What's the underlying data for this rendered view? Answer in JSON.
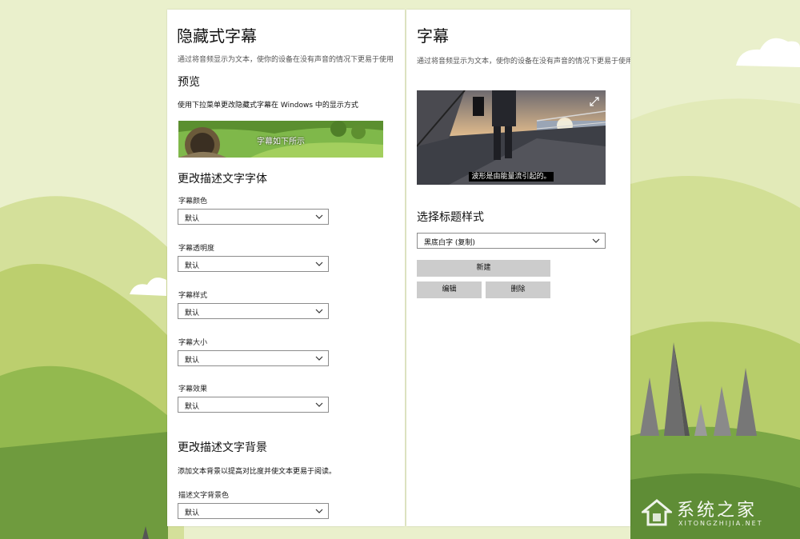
{
  "left": {
    "title": "隐藏式字幕",
    "description": "通过将音频显示为文本，使你的设备在没有声音的情况下更易于使用",
    "preview_heading": "预览",
    "preview_text": "使用下拉菜单更改隐藏式字幕在 Windows 中的显示方式",
    "preview_caption": "字幕如下所示",
    "font_heading": "更改描述文字字体",
    "font_settings": [
      {
        "label": "字幕颜色",
        "value": "默认"
      },
      {
        "label": "字幕透明度",
        "value": "默认"
      },
      {
        "label": "字幕样式",
        "value": "默认"
      },
      {
        "label": "字幕大小",
        "value": "默认"
      },
      {
        "label": "字幕效果",
        "value": "默认"
      }
    ],
    "background_heading": "更改描述文字背景",
    "background_text": "添加文本背景以提高对比度并使文本更易于阅读。",
    "background_setting": {
      "label": "描述文字背景色",
      "value": "默认"
    }
  },
  "right": {
    "title": "字幕",
    "description": "通过将音频显示为文本，使你的设备在没有声音的情况下更易于使用",
    "video_caption": "波形是由能量流引起的。",
    "expand_icon": "expand-icon",
    "style_heading": "选择标题样式",
    "style_value": "黑底白字 (复制)",
    "buttons": {
      "new": "新建",
      "edit": "编辑",
      "delete": "删除"
    }
  },
  "watermark": {
    "name": "系统之家",
    "url": "XITONGZHIJIA.NET"
  },
  "colors": {
    "button_bg": "#cccccc",
    "panel_bg": "#ffffff",
    "grass": "#8cc152"
  }
}
